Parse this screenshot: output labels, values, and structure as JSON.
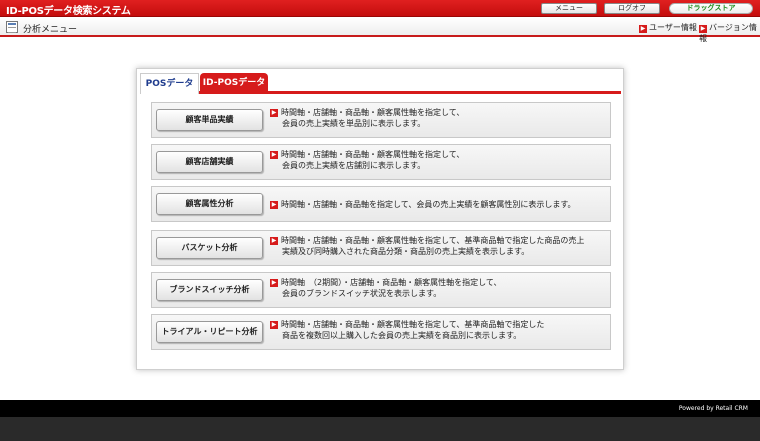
{
  "header": {
    "app_title": "ID-POSデータ検索システム",
    "menu_button": "メニュー",
    "logout_button": "ログオフ",
    "store_button": "ドラッグストア"
  },
  "subheader": {
    "title": "分析メニュー",
    "user_info": "ユーザー情報",
    "version_info": "バージョン情報"
  },
  "tabs": [
    {
      "label": "POSデータ",
      "active": false
    },
    {
      "label": "ID-POSデータ",
      "active": true
    }
  ],
  "rows": [
    {
      "button": "顧客単品実績",
      "line1": "時間軸・店舗軸・商品軸・顧客属性軸を指定して、",
      "line2": "会員の売上実績を単品別に表示します。"
    },
    {
      "button": "顧客店舗実績",
      "line1": "時間軸・店舗軸・商品軸・顧客属性軸を指定して、",
      "line2": "会員の売上実績を店舗別に表示します。"
    },
    {
      "button": "顧客属性分析",
      "line1": "時間軸・店舗軸・商品軸を指定して、会員の売上実績を顧客属性別に表示します。",
      "line2": ""
    },
    {
      "button": "バスケット分析",
      "line1": "時間軸・店舗軸・商品軸・顧客属性軸を指定して、基準商品軸で指定した商品の売上",
      "line2": "実績及び同時購入された商品分類・商品別の売上実績を表示します。"
    },
    {
      "button": "ブランドスイッチ分析",
      "line1": "時間軸　（2期間）・店舗軸・商品軸・顧客属性軸を指定して、",
      "line2": "会員のブランドスイッチ状況を表示します。"
    },
    {
      "button": "トライアル・リピート分析",
      "line1": "時間軸・店舗軸・商品軸・顧客属性軸を指定して、基準商品軸で指定した",
      "line2": "商品を複数回以上購入した会員の売上実績を商品別に表示します。"
    }
  ],
  "footer": {
    "powered_by": "Powered by Retail CRM"
  },
  "colors": {
    "brand_red": "#d61b1b",
    "store_green": "#1a8a1a",
    "tab_blue": "#1f3c8e"
  }
}
